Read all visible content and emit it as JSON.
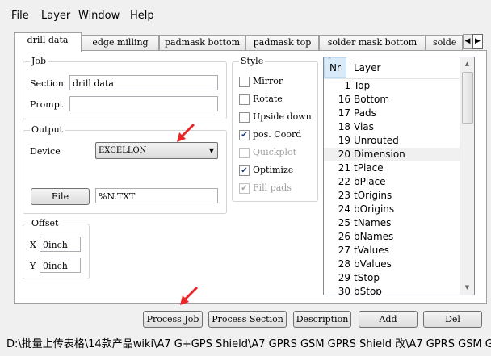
{
  "menu": [
    "File",
    "Layer",
    "Window",
    "Help"
  ],
  "tabs": [
    "drill data",
    "edge milling",
    "padmask bottom",
    "padmask top",
    "solder mask bottom",
    "solde"
  ],
  "tab_scroll": {
    "left": "◀",
    "right": "▶"
  },
  "job": {
    "title": "Job",
    "section_label": "Section",
    "section_value": "drill data",
    "prompt_label": "Prompt",
    "prompt_value": ""
  },
  "output": {
    "title": "Output",
    "device_label": "Device",
    "device_value": "EXCELLON",
    "file_button": "File",
    "file_value": "%N.TXT"
  },
  "offset": {
    "title": "Offset",
    "x_label": "X",
    "x_value": "0inch",
    "y_label": "Y",
    "y_value": "0inch"
  },
  "style": {
    "title": "Style",
    "options": [
      {
        "label": "Mirror",
        "checked": false,
        "enabled": true
      },
      {
        "label": "Rotate",
        "checked": false,
        "enabled": true
      },
      {
        "label": "Upside down",
        "checked": false,
        "enabled": true
      },
      {
        "label": "pos. Coord",
        "checked": true,
        "enabled": true
      },
      {
        "label": "Quickplot",
        "checked": false,
        "enabled": false
      },
      {
        "label": "Optimize",
        "checked": true,
        "enabled": true
      },
      {
        "label": "Fill pads",
        "checked": true,
        "enabled": false
      }
    ]
  },
  "layers": {
    "header_nr": "Nr",
    "header_layer": "Layer",
    "rows": [
      {
        "nr": "1",
        "name": "Top"
      },
      {
        "nr": "16",
        "name": "Bottom"
      },
      {
        "nr": "17",
        "name": "Pads"
      },
      {
        "nr": "18",
        "name": "Vias"
      },
      {
        "nr": "19",
        "name": "Unrouted"
      },
      {
        "nr": "20",
        "name": "Dimension"
      },
      {
        "nr": "21",
        "name": "tPlace"
      },
      {
        "nr": "22",
        "name": "bPlace"
      },
      {
        "nr": "23",
        "name": "tOrigins"
      },
      {
        "nr": "24",
        "name": "bOrigins"
      },
      {
        "nr": "25",
        "name": "tNames"
      },
      {
        "nr": "26",
        "name": "bNames"
      },
      {
        "nr": "27",
        "name": "tValues"
      },
      {
        "nr": "28",
        "name": "bValues"
      },
      {
        "nr": "29",
        "name": "tStop"
      },
      {
        "nr": "30",
        "name": "bStop"
      }
    ]
  },
  "buttons": {
    "process_job": "Process Job",
    "process_section": "Process Section",
    "description": "Description",
    "add": "Add",
    "del": "Del"
  },
  "status_path": "D:\\批量上传表格\\14款产品wiki\\A7 G+GPS Shield\\A7 GPRS GSM GPRS Shield 改\\A7 GPRS GSM GPS Shie",
  "colors": {
    "annotation_arrow": "#e8262a",
    "check_mark": "#1b3b7e"
  }
}
